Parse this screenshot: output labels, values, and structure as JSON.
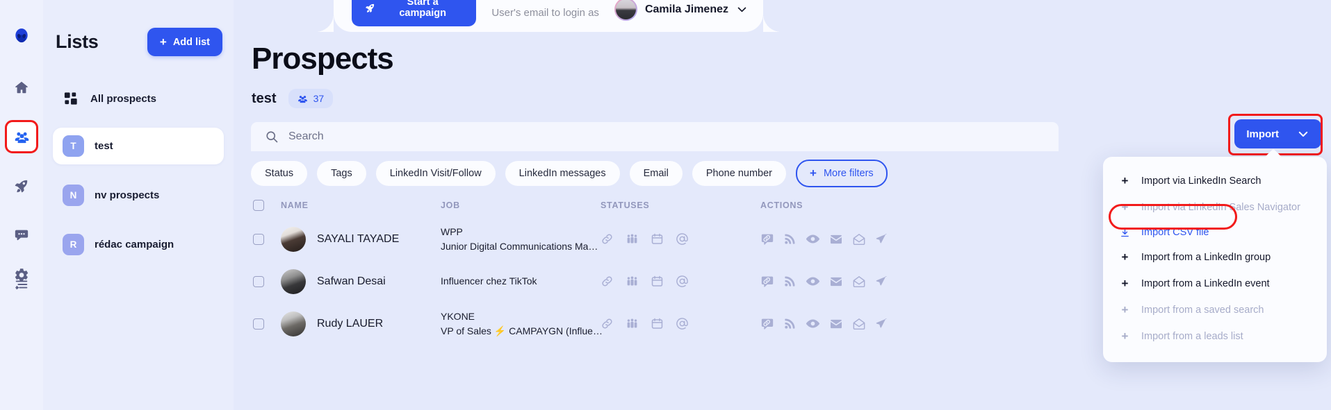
{
  "rail": {
    "logo_icon": "alien-logo-icon",
    "items": [
      {
        "name": "home",
        "icon": "home-icon",
        "active": false
      },
      {
        "name": "prospects",
        "icon": "people-icon",
        "active": true,
        "highlighted": true
      },
      {
        "name": "campaigns",
        "icon": "rocket-icon",
        "active": false
      },
      {
        "name": "messages",
        "icon": "chat-bubble-icon",
        "active": false
      },
      {
        "name": "tasks",
        "icon": "task-list-icon",
        "active": false
      }
    ],
    "settings_icon": "gear-icon"
  },
  "lists_panel": {
    "title": "Lists",
    "add_button": {
      "label": "Add list",
      "plus": "+"
    },
    "all_prospects": {
      "label": "All prospects",
      "icon": "grid-icon"
    },
    "items": [
      {
        "initial": "T",
        "label": "test",
        "selected": true
      },
      {
        "initial": "N",
        "label": "nv prospects",
        "selected": false
      },
      {
        "initial": "R",
        "label": "rédac campaign",
        "selected": false
      }
    ]
  },
  "header": {
    "campaign_button": {
      "label": "Start a campaign",
      "icon": "rocket-icon"
    },
    "login_as_label": "User's email to login as",
    "user": {
      "name": "Camila Jimenez",
      "chevron": "chevron-down-icon",
      "avatar": "avatar"
    }
  },
  "page": {
    "title": "Prospects",
    "list_name": "test",
    "count": "37",
    "count_icon": "people-icon"
  },
  "search": {
    "placeholder": "Search",
    "value": "",
    "icon": "search-icon"
  },
  "import": {
    "button_label": "Import",
    "chevron": "chevron-down-icon",
    "menu": [
      {
        "label": "Import via LinkedIn Search",
        "icon": "plus-icon",
        "state": "enabled"
      },
      {
        "label": "Import via LinkedIn Sales Navigator",
        "icon": "plus-icon",
        "state": "disabled"
      },
      {
        "label": "Import CSV file",
        "icon": "download-icon",
        "state": "accent"
      },
      {
        "label": "Import from a LinkedIn group",
        "icon": "plus-icon",
        "state": "enabled"
      },
      {
        "label": "Import from a LinkedIn event",
        "icon": "plus-icon",
        "state": "enabled"
      },
      {
        "label": "Import from a saved search",
        "icon": "plus-icon",
        "state": "disabled"
      },
      {
        "label": "Import from a leads list",
        "icon": "plus-icon",
        "state": "disabled"
      }
    ]
  },
  "filters": {
    "chips": [
      {
        "label": "Status"
      },
      {
        "label": "Tags"
      },
      {
        "label": "LinkedIn Visit/Follow"
      },
      {
        "label": "LinkedIn messages"
      },
      {
        "label": "Email"
      },
      {
        "label": "Phone number"
      }
    ],
    "more": {
      "label": "More filters",
      "plus": "+"
    }
  },
  "table": {
    "headers": {
      "name": "NAME",
      "job": "JOB",
      "statuses": "STATUSES",
      "actions": "ACTIONS"
    },
    "status_icons": [
      "link-icon",
      "people-icon",
      "calendar-icon",
      "at-sign-icon"
    ],
    "action_icons": [
      "message-link-icon",
      "broadcast-icon",
      "eye-icon",
      "envelope-closed-icon",
      "envelope-open-icon",
      "send-icon"
    ],
    "rows": [
      {
        "name": "SAYALI TAYADE",
        "company": "WPP",
        "job_title": "Junior Digital Communications Ma…",
        "has_bolt": false,
        "bolt_text": ""
      },
      {
        "name": "Safwan Desai",
        "company": "",
        "job_title": "Influencer chez TikTok",
        "has_bolt": false,
        "bolt_text": ""
      },
      {
        "name": "Rudy LAUER",
        "company": "YKONE",
        "job_title": "VP of Sales",
        "has_bolt": true,
        "bolt_text": "CAMPAYGN (Influe…"
      }
    ]
  },
  "colors": {
    "accent": "#2f55ef",
    "highlight": "#f21b1b",
    "background": "#e4e9fb",
    "panel": "#fbfcff",
    "muted": "#9297bc",
    "bolt": "#ff8a16"
  }
}
